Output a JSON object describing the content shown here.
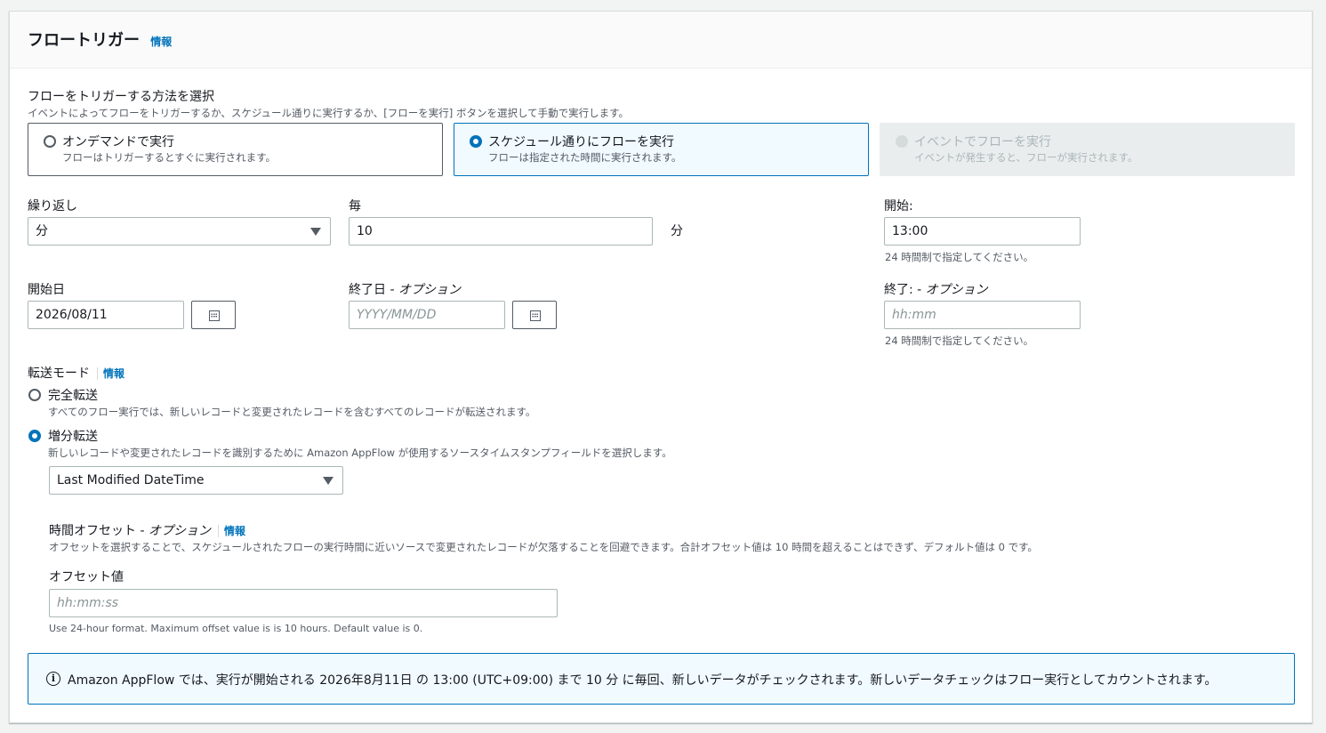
{
  "header": {
    "title": "フロートリガー",
    "info": "情報"
  },
  "trigger": {
    "label": "フローをトリガーする方法を選択",
    "description": "イベントによってフローをトリガーするか、スケジュール通りに実行するか、[フローを実行] ボタンを選択して手動で実行します。",
    "options": [
      {
        "title": "オンデマンドで実行",
        "desc": "フローはトリガーするとすぐに実行されます。"
      },
      {
        "title": "スケジュール通りにフローを実行",
        "desc": "フローは指定された時間に実行されます。"
      },
      {
        "title": "イベントでフローを実行",
        "desc": "イベントが発生すると、フローが実行されます。"
      }
    ]
  },
  "schedule": {
    "repeat_label": "繰り返し",
    "repeat_value": "分",
    "every_label": "毎",
    "every_value": "10",
    "every_unit": "分",
    "start_time_label": "開始:",
    "start_time_value": "13:00",
    "time_hint": "24 時間制で指定してください。",
    "start_date_label": "開始日",
    "start_date_value": "2026/08/11",
    "end_date_label_main": "終了日 - ",
    "end_date_label_opt": "オプション",
    "end_date_placeholder": "YYYY/MM/DD",
    "end_time_label_main": "終了: - ",
    "end_time_label_opt": "オプション",
    "end_time_placeholder": "hh:mm",
    "end_time_hint": "24 時間制で指定してください。"
  },
  "transfer": {
    "label": "転送モード",
    "info": "情報",
    "full_title": "完全転送",
    "full_desc": "すべてのフロー実行では、新しいレコードと変更されたレコードを含むすべてのレコードが転送されます。",
    "incr_title": "増分転送",
    "incr_desc": "新しいレコードや変更されたレコードを識別するために Amazon AppFlow が使用するソースタイムスタンプフィールドを選択します。",
    "field_value": "Last Modified DateTime",
    "offset_label_main": "時間オフセット - ",
    "offset_label_opt": "オプション",
    "offset_info": "情報",
    "offset_desc": "オフセットを選択することで、スケジュールされたフローの実行時間に近いソースで変更されたレコードが欠落することを回避できます。合計オフセット値は 10 時間を超えることはできず、デフォルト値は 0 です。",
    "offset_value_label": "オフセット値",
    "offset_placeholder": "hh:mm:ss",
    "offset_hint": "Use 24-hour format. Maximum offset value is is 10 hours. Default value is 0."
  },
  "flash": {
    "icon": "info-icon",
    "message": "Amazon AppFlow では、実行が開始される 2026年8月11日 の 13:00 (UTC+09:00) まで 10 分 に毎回、新しいデータがチェックされます。新しいデータチェックはフロー実行としてカウントされます。"
  },
  "colors": {
    "accent": "#0073bb",
    "selected_bg": "#f1faff",
    "disabled_bg": "#eaeded"
  }
}
